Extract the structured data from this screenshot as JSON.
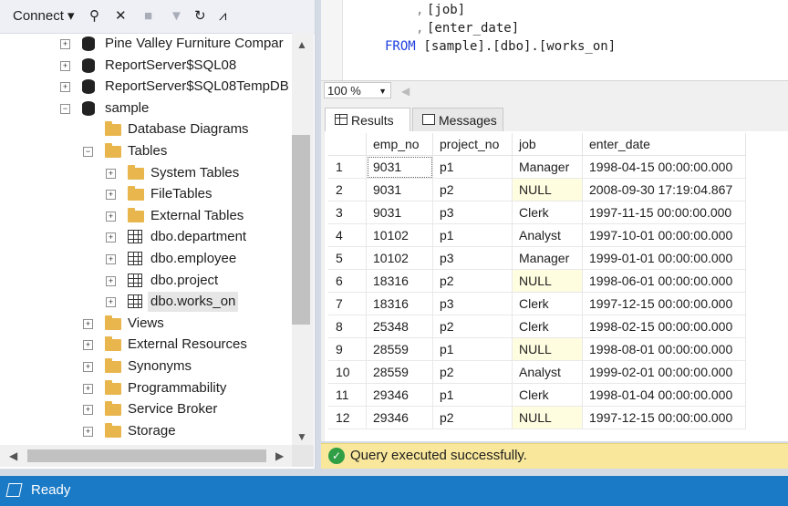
{
  "object_explorer": {
    "toolbar": {
      "connect_label": "Connect"
    },
    "tree": [
      {
        "label": "Pine Valley Furniture Compar",
        "kind": "db",
        "expander": "+"
      },
      {
        "label": "ReportServer$SQL08",
        "kind": "db",
        "expander": "+"
      },
      {
        "label": "ReportServer$SQL08TempDB",
        "kind": "db",
        "expander": "+"
      },
      {
        "label": "sample",
        "kind": "db",
        "expander": "−"
      },
      {
        "label": "Database Diagrams",
        "kind": "folder",
        "expander": ""
      },
      {
        "label": "Tables",
        "kind": "folder",
        "expander": "−"
      },
      {
        "label": "System Tables",
        "kind": "folder",
        "expander": "+"
      },
      {
        "label": "FileTables",
        "kind": "folder",
        "expander": "+"
      },
      {
        "label": "External Tables",
        "kind": "folder",
        "expander": "+"
      },
      {
        "label": "dbo.department",
        "kind": "table",
        "expander": "+"
      },
      {
        "label": "dbo.employee",
        "kind": "table",
        "expander": "+"
      },
      {
        "label": "dbo.project",
        "kind": "table",
        "expander": "+"
      },
      {
        "label": "dbo.works_on",
        "kind": "table",
        "expander": "+",
        "selected": true
      },
      {
        "label": "Views",
        "kind": "folder",
        "expander": "+"
      },
      {
        "label": "External Resources",
        "kind": "folder",
        "expander": "+"
      },
      {
        "label": "Synonyms",
        "kind": "folder",
        "expander": "+"
      },
      {
        "label": "Programmability",
        "kind": "folder",
        "expander": "+"
      },
      {
        "label": "Service Broker",
        "kind": "folder",
        "expander": "+"
      },
      {
        "label": "Storage",
        "kind": "folder",
        "expander": "+"
      }
    ]
  },
  "editor": {
    "line1_prefix": ",",
    "line1": "[job]",
    "line2_prefix": ",",
    "line2": "[enter_date]",
    "line3_kw": "FROM",
    "line3": " [sample].[dbo].[works_on]"
  },
  "zoom": {
    "value": "100 %"
  },
  "tabs": {
    "results": "Results",
    "messages": "Messages"
  },
  "grid": {
    "columns": [
      "emp_no",
      "project_no",
      "job",
      "enter_date"
    ],
    "rows": [
      [
        "1",
        "9031",
        "p1",
        "Manager",
        "1998-04-15 00:00:00.000"
      ],
      [
        "2",
        "9031",
        "p2",
        "NULL",
        "2008-09-30 17:19:04.867"
      ],
      [
        "3",
        "9031",
        "p3",
        "Clerk",
        "1997-11-15 00:00:00.000"
      ],
      [
        "4",
        "10102",
        "p1",
        "Analyst",
        "1997-10-01 00:00:00.000"
      ],
      [
        "5",
        "10102",
        "p3",
        "Manager",
        "1999-01-01 00:00:00.000"
      ],
      [
        "6",
        "18316",
        "p2",
        "NULL",
        "1998-06-01 00:00:00.000"
      ],
      [
        "7",
        "18316",
        "p3",
        "Clerk",
        "1997-12-15 00:00:00.000"
      ],
      [
        "8",
        "25348",
        "p2",
        "Clerk",
        "1998-02-15 00:00:00.000"
      ],
      [
        "9",
        "28559",
        "p1",
        "NULL",
        "1998-08-01 00:00:00.000"
      ],
      [
        "10",
        "28559",
        "p2",
        "Analyst",
        "1999-02-01 00:00:00.000"
      ],
      [
        "11",
        "29346",
        "p1",
        "Clerk",
        "1998-01-04 00:00:00.000"
      ],
      [
        "12",
        "29346",
        "p2",
        "NULL",
        "1997-12-15 00:00:00.000"
      ]
    ]
  },
  "query_status": "Query executed successfully.",
  "status_bar": "Ready",
  "colors": {
    "status_bar": "#1a7ac6",
    "query_success_bg": "#f9e89c",
    "null_cell_bg": "#fffde0",
    "keyword": "#1f40e0"
  }
}
